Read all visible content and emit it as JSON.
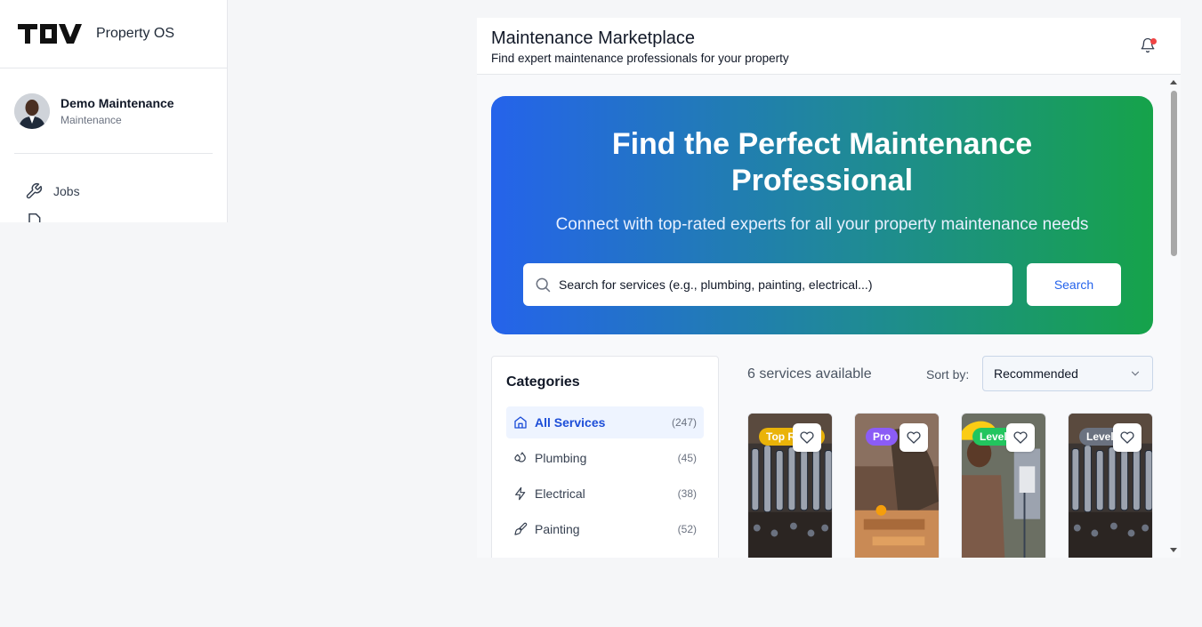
{
  "brand": {
    "logo_text": "TOV",
    "name": "Property OS"
  },
  "user": {
    "name": "Demo Maintenance",
    "role": "Maintenance"
  },
  "nav": {
    "items": [
      {
        "label": "Jobs",
        "icon": "wrench-icon"
      }
    ]
  },
  "header": {
    "title": "Maintenance Marketplace",
    "subtitle": "Find expert maintenance professionals for your property",
    "notification_icon": "bell-icon",
    "notification_color": "#ef4444"
  },
  "hero": {
    "title": "Find the Perfect Maintenance Professional",
    "subtitle": "Connect with top-rated experts for all your property maintenance needs",
    "search_placeholder": "Search for services (e.g., plumbing, painting, electrical...)",
    "search_button": "Search",
    "gradient": [
      "#2563eb",
      "#16a34a"
    ]
  },
  "categories": {
    "title": "Categories",
    "items": [
      {
        "label": "All Services",
        "count": "(247)",
        "icon": "home-icon",
        "active": true
      },
      {
        "label": "Plumbing",
        "count": "(45)",
        "icon": "droplets-icon"
      },
      {
        "label": "Electrical",
        "count": "(38)",
        "icon": "lightning-icon"
      },
      {
        "label": "Painting",
        "count": "(52)",
        "icon": "paintbrush-icon"
      }
    ]
  },
  "results": {
    "count_text": "6 services available",
    "sort_label": "Sort by:",
    "sort_value": "Recommended"
  },
  "cards": [
    {
      "badge": "Top Rated",
      "badge_color": "#eab308",
      "image": "tools-photo"
    },
    {
      "badge": "Pro",
      "badge_color": "#8b5cf6",
      "image": "carpentry-photo"
    },
    {
      "badge": "Level 2",
      "badge_color": "#22c55e",
      "image": "electrician-photo"
    },
    {
      "badge": "Level 1",
      "badge_color": "#6b7280",
      "image": "tools-photo"
    }
  ]
}
